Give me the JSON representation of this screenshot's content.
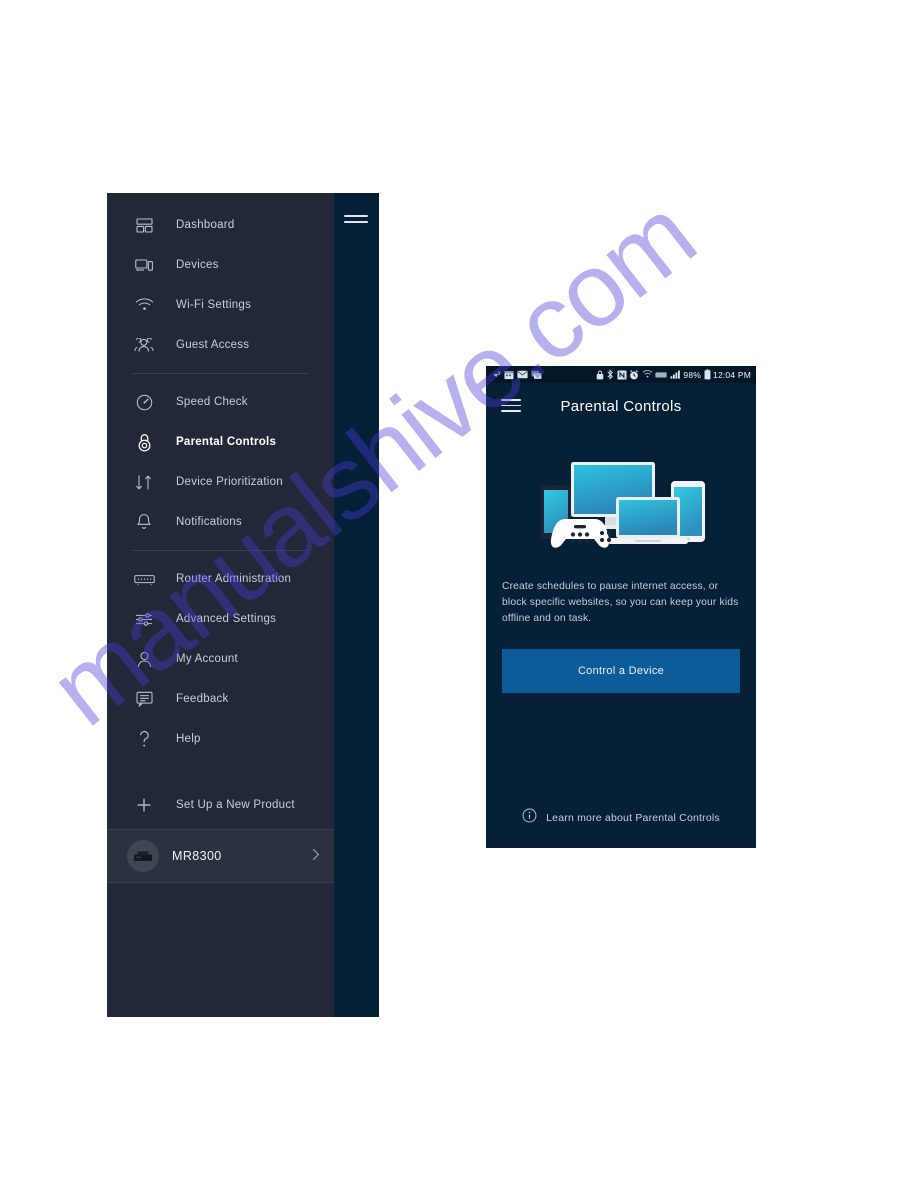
{
  "watermark": {
    "text": "manualshive.com"
  },
  "drawer": {
    "hamburger_icon": "hamburger-menu-icon",
    "groups": [
      {
        "items": [
          {
            "label": "Dashboard",
            "icon": "dashboard-icon",
            "active": false
          },
          {
            "label": "Devices",
            "icon": "devices-icon",
            "active": false
          },
          {
            "label": "Wi-Fi Settings",
            "icon": "wifi-icon",
            "active": false
          },
          {
            "label": "Guest Access",
            "icon": "guest-access-icon",
            "active": false
          }
        ]
      },
      {
        "items": [
          {
            "label": "Speed Check",
            "icon": "speedometer-icon",
            "active": false
          },
          {
            "label": "Parental Controls",
            "icon": "lock-icon",
            "active": true
          },
          {
            "label": "Device Prioritization",
            "icon": "up-down-arrows-icon",
            "active": false
          },
          {
            "label": "Notifications",
            "icon": "bell-icon",
            "active": false
          }
        ]
      },
      {
        "items": [
          {
            "label": "Router Administration",
            "icon": "router-icon",
            "active": false
          },
          {
            "label": "Advanced Settings",
            "icon": "sliders-icon",
            "active": false
          },
          {
            "label": "My Account",
            "icon": "user-icon",
            "active": false
          },
          {
            "label": "Feedback",
            "icon": "chat-bubble-icon",
            "active": false
          },
          {
            "label": "Help",
            "icon": "question-mark-icon",
            "active": false
          }
        ]
      }
    ],
    "setup": {
      "label": "Set Up a New Product",
      "icon": "plus-icon"
    },
    "device": {
      "name": "MR8300",
      "avatar_icon": "router-thumbnail-icon",
      "chevron_icon": "chevron-right-icon"
    }
  },
  "phone": {
    "statusbar": {
      "left_icons": [
        "phone-missed-icon",
        "calendar-icon",
        "mail-icon",
        "messages-icon"
      ],
      "right_icons": [
        "lock-icon",
        "bluetooth-icon",
        "nfc-icon",
        "alarm-icon",
        "wifi-icon",
        "hd-voice-icon",
        "signal-bars-icon"
      ],
      "battery_percent": "98%",
      "battery_icon": "battery-icon",
      "time": "12:04 PM"
    },
    "appbar": {
      "menu_icon": "hamburger-menu-icon",
      "title": "Parental Controls"
    },
    "hero": {
      "illustration_icon": "devices-illustration",
      "parts": [
        "monitor",
        "smartphone",
        "laptop",
        "tablet",
        "game-controller"
      ]
    },
    "body_text": "Create schedules to pause internet access, or block specific websites, so you can keep your kids offline and on task.",
    "cta_label": "Control a Device",
    "learn_more": {
      "icon": "info-icon",
      "label": "Learn more about Parental Controls"
    },
    "colors": {
      "background": "#062035",
      "cta": "#0b5c99",
      "screen_teal": "#2aa8c8",
      "device_light": "#e9eef3"
    }
  }
}
